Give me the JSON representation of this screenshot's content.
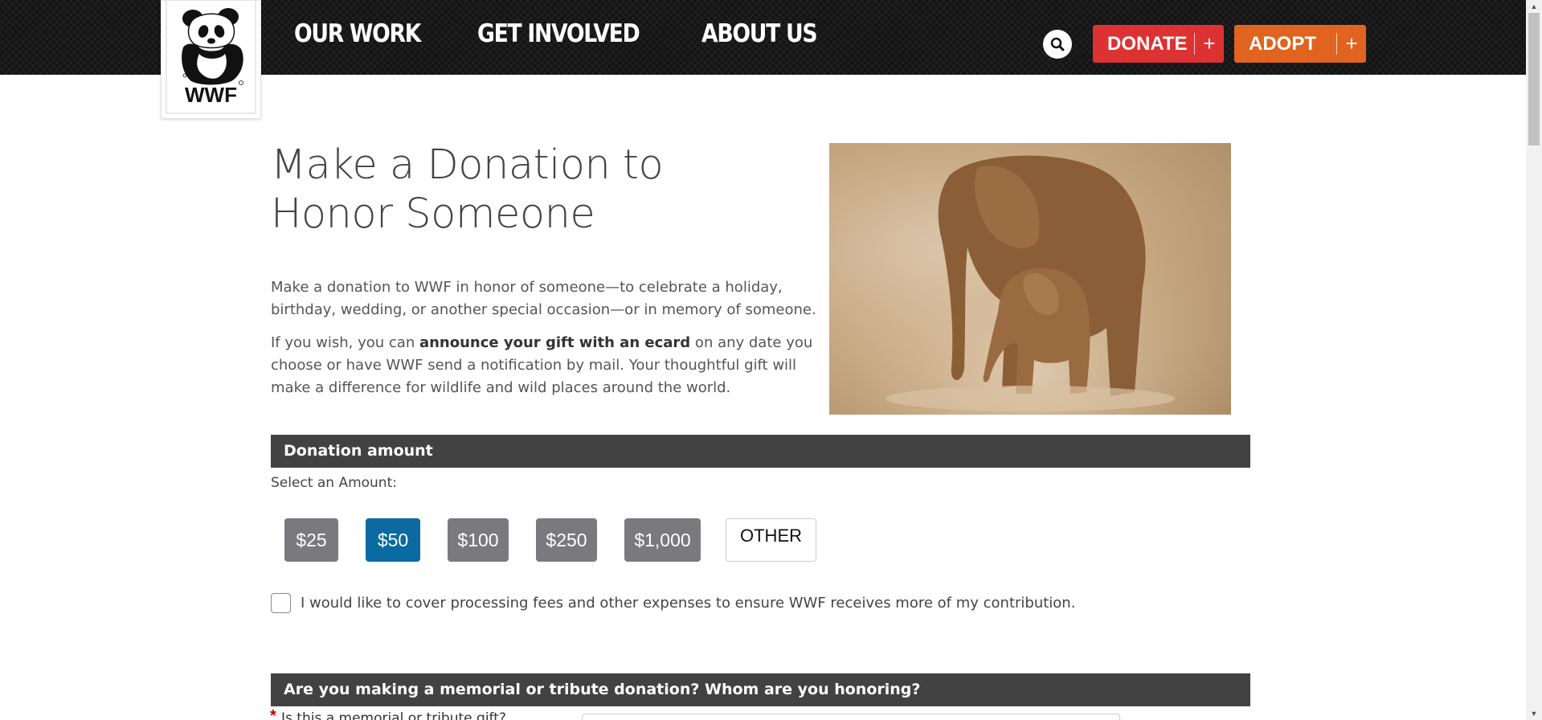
{
  "header": {
    "logo_text": "WWF",
    "nav": [
      {
        "label": "OUR WORK"
      },
      {
        "label": "GET INVOLVED"
      },
      {
        "label": "ABOUT US"
      }
    ],
    "donate_label": "DONATE",
    "adopt_label": "ADOPT",
    "plus": "+"
  },
  "main": {
    "title": "Make a Donation to Honor Someone",
    "para1": "Make a donation to WWF in honor of someone—to celebrate a holiday, birthday, wedding, or another special occasion—or in memory of someone.",
    "para2_pre": "If you wish, you can ",
    "para2_bold": "announce your gift with an ecard",
    "para2_post": " on any date you choose or have WWF send a notification by mail. Your thoughtful gift will make a difference for wildlife and wild places around the world."
  },
  "donation": {
    "section_title": "Donation amount",
    "select_label": "Select an Amount:",
    "amounts": [
      {
        "label": "$25",
        "selected": false
      },
      {
        "label": "$50",
        "selected": true
      },
      {
        "label": "$100",
        "selected": false
      },
      {
        "label": "$250",
        "selected": false
      },
      {
        "label": "$1,000",
        "selected": false
      }
    ],
    "other_label": "OTHER",
    "fees_label": "I would like to cover processing fees and other expenses to ensure WWF receives more of my contribution.",
    "fees_checked": false
  },
  "tribute": {
    "section_title": "Are you making a memorial or tribute donation? Whom are you honoring?",
    "question_label": "Is this a memorial or tribute gift?",
    "required_mark": "*"
  },
  "colors": {
    "donate": "#dc3232",
    "adopt": "#e0641f",
    "selected_amount": "#0a6aa1",
    "amount_button": "#7a7a7e",
    "section_bar": "#424242"
  }
}
